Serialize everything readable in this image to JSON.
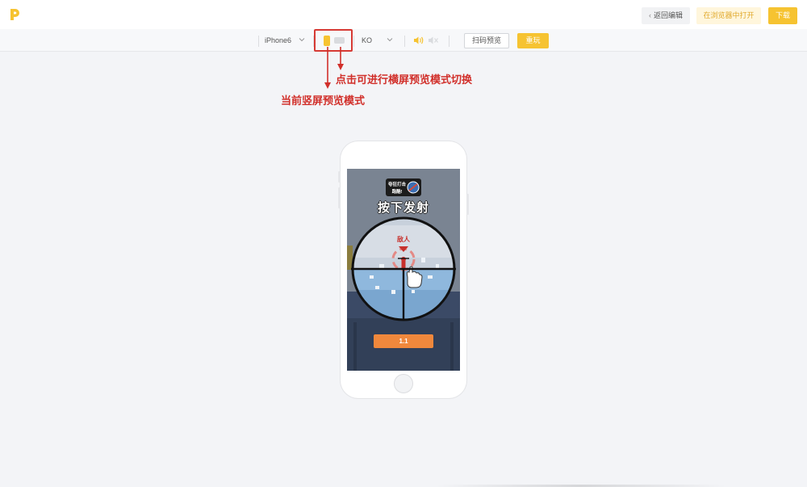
{
  "header": {
    "logo_icon": "p-logo-icon",
    "back_label": "返回编辑",
    "open_in_browser_label": "在浏览器中打开",
    "download_label": "下载",
    "accent_color": "#f6c331"
  },
  "toolbar": {
    "device": "iPhone6",
    "orientation_portrait_icon": "portrait-icon",
    "orientation_landscape_icon": "landscape-icon",
    "network": "KO",
    "sound_on_icon": "volume-on-icon",
    "sound_off_icon": "volume-off-icon",
    "scan_preview_label": "扫码预览",
    "replay_label": "重玩"
  },
  "annotations": {
    "landscape_hint": "点击可进行横屏预览模式切换",
    "portrait_hint": "当前竖屏预览模式",
    "color": "#d12f2a"
  },
  "game": {
    "logo_line1": "夸狂打击",
    "logo_line2": "跑酷!",
    "title": "按下发射",
    "enemy_label": "敌人",
    "timer": "1.1"
  }
}
